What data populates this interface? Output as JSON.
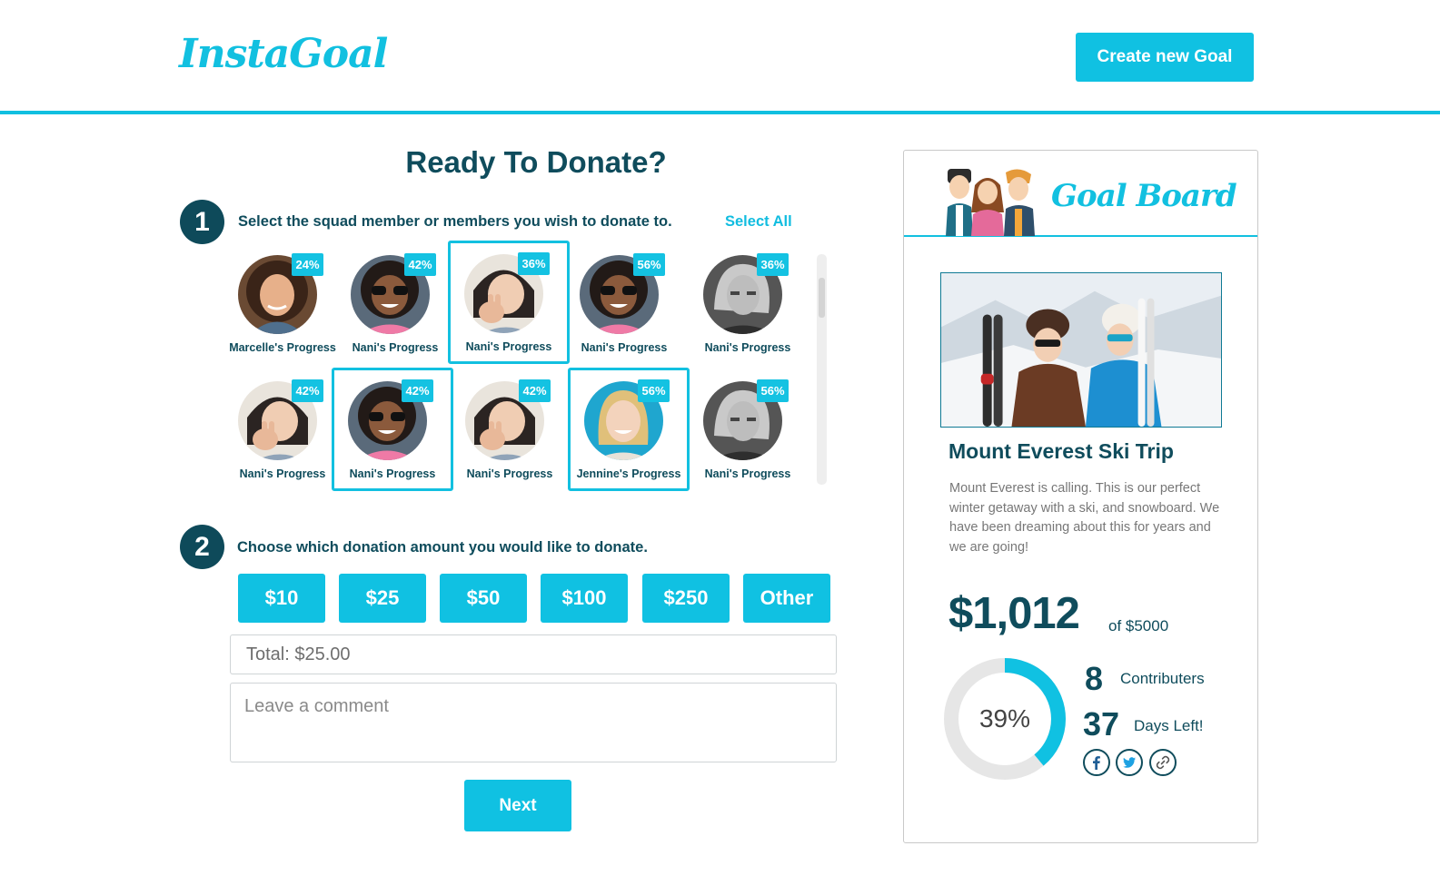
{
  "header": {
    "logo": "InstaGoal",
    "create_button": "Create new Goal"
  },
  "donate": {
    "title": "Ready To Donate?",
    "step1": {
      "number": "1",
      "text": "Select the squad member or members you wish to donate to.",
      "select_all": "Select All"
    },
    "step2": {
      "number": "2",
      "text": "Choose which donation amount you would like to donate."
    },
    "members": [
      {
        "name": "Marcelle's Progress",
        "percent": "24%",
        "selected": false,
        "avatar": "curly-hair-woman"
      },
      {
        "name": "Nani's Progress",
        "percent": "42%",
        "selected": false,
        "avatar": "sunglasses-woman"
      },
      {
        "name": "Nani's Progress",
        "percent": "36%",
        "selected": true,
        "avatar": "peace-sign-woman"
      },
      {
        "name": "Nani's Progress",
        "percent": "56%",
        "selected": false,
        "avatar": "sunglasses-woman"
      },
      {
        "name": "Nani's Progress",
        "percent": "36%",
        "selected": false,
        "avatar": "bw-blonde-woman"
      },
      {
        "name": "Nani's Progress",
        "percent": "42%",
        "selected": false,
        "avatar": "peace-sign-woman"
      },
      {
        "name": "Nani's Progress",
        "percent": "42%",
        "selected": true,
        "avatar": "sunglasses-woman"
      },
      {
        "name": "Nani's Progress",
        "percent": "42%",
        "selected": false,
        "avatar": "peace-sign-woman"
      },
      {
        "name": "Jennine's Progress",
        "percent": "56%",
        "selected": true,
        "avatar": "blonde-smiling-woman"
      },
      {
        "name": "Nani's Progress",
        "percent": "56%",
        "selected": false,
        "avatar": "bw-blonde-woman"
      }
    ],
    "amounts": [
      "$10",
      "$25",
      "$50",
      "$100",
      "$250",
      "Other"
    ],
    "total_value": "Total: $25.00",
    "comment_placeholder": "Leave a comment",
    "next_button": "Next"
  },
  "goal_board": {
    "title": "Goal Board",
    "goal_title": "Mount Everest Ski Trip",
    "description": "Mount Everest is calling. This is our perfect winter getaway with a ski, and snowboard. We have been dreaming about this for years and we are going!",
    "raised": "$1,012",
    "of_total": "of $5000",
    "progress_label": "39%",
    "progress_fraction": 0.39,
    "contributors_count": "8",
    "contributors_label": "Contributers",
    "days_count": "37",
    "days_label": "Days Left!",
    "social_icons": [
      "facebook-icon",
      "twitter-icon",
      "link-icon"
    ]
  },
  "colors": {
    "accent": "#10c1e2",
    "dark": "#0f4c5c",
    "ring_track": "#e6e6e6"
  }
}
